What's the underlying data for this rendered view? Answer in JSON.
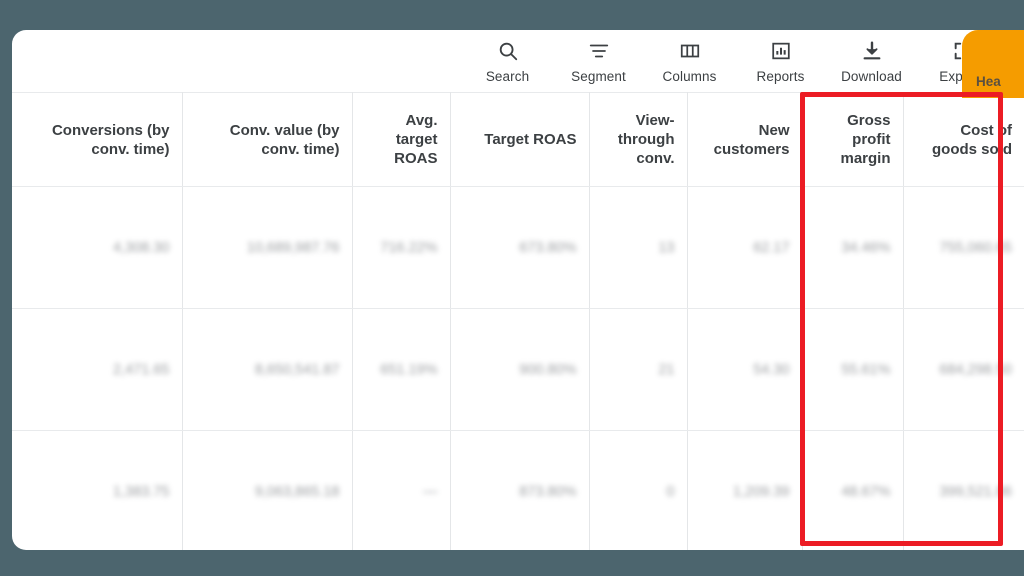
{
  "background_color": "#4c656e",
  "toolbar": {
    "items": [
      {
        "label": "Search",
        "icon": "search-icon"
      },
      {
        "label": "Segment",
        "icon": "segment-icon"
      },
      {
        "label": "Columns",
        "icon": "columns-icon"
      },
      {
        "label": "Reports",
        "icon": "reports-icon"
      },
      {
        "label": "Download",
        "icon": "download-icon"
      },
      {
        "label": "Expand",
        "icon": "expand-icon"
      }
    ]
  },
  "side_tab": {
    "label": "Hea",
    "color": "#f59c00"
  },
  "highlight": {
    "color": "#ec1c24",
    "covers": [
      "Gross profit margin",
      "Cost of goods sold"
    ]
  },
  "table": {
    "columns": [
      {
        "header": "Conversions (by conv. time)",
        "highlighted": false
      },
      {
        "header": "Conv. value (by conv. time)",
        "highlighted": false
      },
      {
        "header": "Avg. target ROAS",
        "highlighted": false
      },
      {
        "header": "Target ROAS",
        "highlighted": false
      },
      {
        "header": "View-through conv.",
        "highlighted": false
      },
      {
        "header": "New customers",
        "highlighted": false
      },
      {
        "header": "Gross profit margin",
        "highlighted": true
      },
      {
        "header": "Cost of goods sold",
        "highlighted": true
      }
    ],
    "rows": [
      {
        "conversions": "4,308.30",
        "conv_value": "10,689,987.76",
        "avg_target_roas": "716.22%",
        "target_roas": "673.80%",
        "view_through_conv": "13",
        "new_customers": "62.17",
        "gross_profit_margin": "34.46%",
        "cost_of_goods_sold": "755,060.65"
      },
      {
        "conversions": "2,471.65",
        "conv_value": "8,650,541.87",
        "avg_target_roas": "651.19%",
        "target_roas": "900.80%",
        "view_through_conv": "21",
        "new_customers": "54.30",
        "gross_profit_margin": "55.61%",
        "cost_of_goods_sold": "684,298.50"
      },
      {
        "conversions": "1,383.75",
        "conv_value": "9,063,865.18",
        "avg_target_roas": "—",
        "target_roas": "873.80%",
        "view_through_conv": "0",
        "new_customers": "1,209.39",
        "gross_profit_margin": "48.67%",
        "cost_of_goods_sold": "399,521.86"
      }
    ]
  }
}
